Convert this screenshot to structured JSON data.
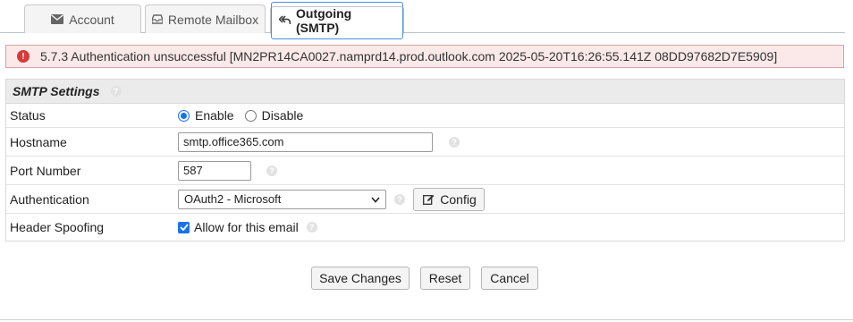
{
  "tabs": [
    {
      "label": "Account",
      "icon": "envelope-icon"
    },
    {
      "label": "Remote Mailbox",
      "icon": "inbox-tray-icon"
    },
    {
      "label": "Outgoing (SMTP)",
      "icon": "reply-all-icon",
      "active": true
    }
  ],
  "error": {
    "message": "5.7.3 Authentication unsuccessful [MN2PR14CA0027.namprd14.prod.outlook.com 2025-05-20T16:26:55.141Z 08DD97682D7E5909]"
  },
  "section": {
    "title": "SMTP Settings"
  },
  "status": {
    "label": "Status",
    "enable_label": "Enable",
    "disable_label": "Disable",
    "selected": "Enable"
  },
  "hostname": {
    "label": "Hostname",
    "value": "smtp.office365.com"
  },
  "port": {
    "label": "Port Number",
    "value": "587"
  },
  "authentication": {
    "label": "Authentication",
    "selected": "OAuth2 - Microsoft",
    "config_label": "Config"
  },
  "spoofing": {
    "label": "Header Spoofing",
    "checkbox_label": "Allow for this email",
    "checked": true
  },
  "actions": {
    "save": "Save Changes",
    "reset": "Reset",
    "cancel": "Cancel"
  },
  "colors": {
    "accent": "#1a73e8",
    "error_bg": "#fbe9ea",
    "error_border": "#d9a0a4",
    "error_icon": "#d63a3a"
  }
}
